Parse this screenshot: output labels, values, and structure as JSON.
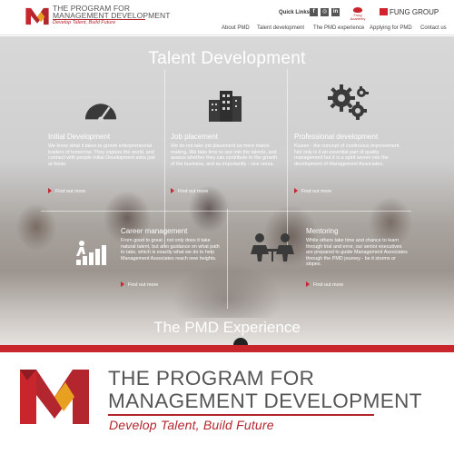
{
  "header": {
    "logo_line1": "THE PROGRAM FOR",
    "logo_line2": "MANAGEMENT DEVELOPMENT",
    "logo_tagline": "Develop Talent, Build Future",
    "quick_links_label": "Quick Links",
    "social": [
      "f",
      "◎",
      "in"
    ],
    "fung_academy_label": "Fung Academy",
    "fung_group_label": "FUNG GROUP",
    "brand_color": "#c9252c",
    "nav": [
      "About PMD",
      "Talent development",
      "The PMD experience",
      "Applying for PMD",
      "Contact us"
    ]
  },
  "hero": {
    "title": "Talent Development",
    "cards": [
      {
        "title": "Initial Development",
        "icon": "speedometer-icon",
        "text": "We know what it takes to groom entrepreneurial leaders of tomorrow. They explore the world, and connect with people Initial Development aims just at these.",
        "link": "Find out more"
      },
      {
        "title": "Job placement",
        "icon": "buildings-icon",
        "text": "We do not take job placement as mere match-making. We take time to see into the talents, and assess whether they can contribute to the growth of the business, and as importantly - vice versa.",
        "link": "Find out more"
      },
      {
        "title": "Professional development",
        "icon": "gears-icon",
        "text": "Kaizen - the concept of continuous improvement. Not only is it an essential part of quality management but it is a spirit woven into the development of Management Associates.",
        "link": "Find out more"
      },
      {
        "title": "Career management",
        "icon": "stairs-climb-icon",
        "text": "From good to great - not only does it take natural talent, but also guidance on what path to take, which is exactly what we do to help Management Associates reach new heights.",
        "link": "Find out more"
      },
      {
        "title": "Mentoring",
        "icon": "mentoring-icon",
        "text": "While others take time and chance to learn through trial and error, our senior executives are prepared to guide Management Associates through the PMD journey - be it storms or slopes.",
        "link": "Find out more"
      }
    ],
    "section2_title": "The PMD Experience"
  },
  "logo": {
    "line1": "THE PROGRAM FOR",
    "line2": "MANAGEMENT DEVELOPMENT",
    "tagline": "Develop Talent, Build Future"
  }
}
